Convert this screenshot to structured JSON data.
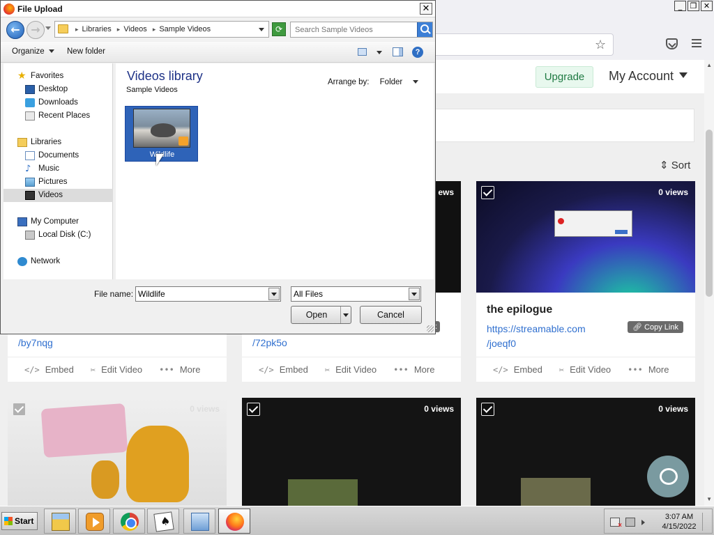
{
  "browser": {
    "upgrade_label": "Upgrade",
    "account_label": "My Account",
    "sort_label": "Sort"
  },
  "cards": [
    {
      "title": "",
      "link_tail": "/by7nqg",
      "views": "",
      "embed": "Embed",
      "edit": "Edit Video",
      "more": "More"
    },
    {
      "title": "",
      "link_tail": "/72pk5o",
      "views": "ews",
      "copy": "k",
      "embed": "Embed",
      "edit": "Edit Video",
      "more": "More"
    },
    {
      "title": "the epilogue",
      "link_head": "https://streamable.com",
      "link_tail": "/joeqf0",
      "views": "0 views",
      "copy": "Copy Link",
      "embed": "Embed",
      "edit": "Edit Video",
      "more": "More"
    },
    {
      "views": "0 views"
    },
    {
      "views": "0 views"
    },
    {
      "views": "0 views"
    }
  ],
  "dialog": {
    "title": "File Upload",
    "breadcrumbs": [
      "Libraries",
      "Videos",
      "Sample Videos"
    ],
    "search_placeholder": "Search Sample Videos",
    "toolbar": {
      "organize": "Organize",
      "new_folder": "New folder"
    },
    "nav": {
      "favorites": "Favorites",
      "desktop": "Desktop",
      "downloads": "Downloads",
      "recent": "Recent Places",
      "libraries": "Libraries",
      "documents": "Documents",
      "music": "Music",
      "pictures": "Pictures",
      "videos": "Videos",
      "computer": "My Computer",
      "disk": "Local Disk (C:)",
      "network": "Network"
    },
    "library_title": "Videos library",
    "library_subtitle": "Sample Videos",
    "arrange_label": "Arrange by:",
    "arrange_value": "Folder",
    "file_item": "Wildlife",
    "file_name_label": "File name:",
    "file_name_value": "Wildlife",
    "file_type": "All Files",
    "open_label": "Open",
    "cancel_label": "Cancel"
  },
  "taskbar": {
    "start_label": "Start",
    "time": "3:07 AM",
    "date": "4/15/2022"
  },
  "colors": {
    "dialog_accent": "#1e3287",
    "selection": "#2e63b8",
    "link": "#2f6fcf",
    "upgrade_green": "#1f7a43"
  }
}
